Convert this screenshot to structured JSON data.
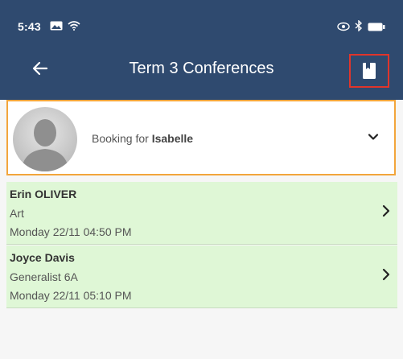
{
  "status_bar": {
    "time": "5:43",
    "left_icons": [
      "photo-icon",
      "wifi-icon"
    ],
    "right_icons": [
      "eye-icon",
      "bluetooth-icon",
      "battery-icon"
    ]
  },
  "app_bar": {
    "title": "Term 3 Conferences",
    "back_icon": "arrow-left-icon",
    "action_icon": "bookmark-icon",
    "action_highlight_color": "#e0352b",
    "background": "#2f4a6f"
  },
  "booking": {
    "prefix": "Booking for",
    "student": "Isabelle",
    "dropdown_icon": "chevron-down-icon",
    "border_color": "#f2a53b"
  },
  "conferences": [
    {
      "teacher": "Erin OLIVER",
      "subject": "Art",
      "datetime": "Monday 22/11 04:50 PM"
    },
    {
      "teacher": "Joyce Davis",
      "subject": "Generalist 6A",
      "datetime": "Monday 22/11 05:10 PM"
    }
  ],
  "colors": {
    "row_background": "#dff7d6",
    "page_background": "#f6f6f6"
  }
}
